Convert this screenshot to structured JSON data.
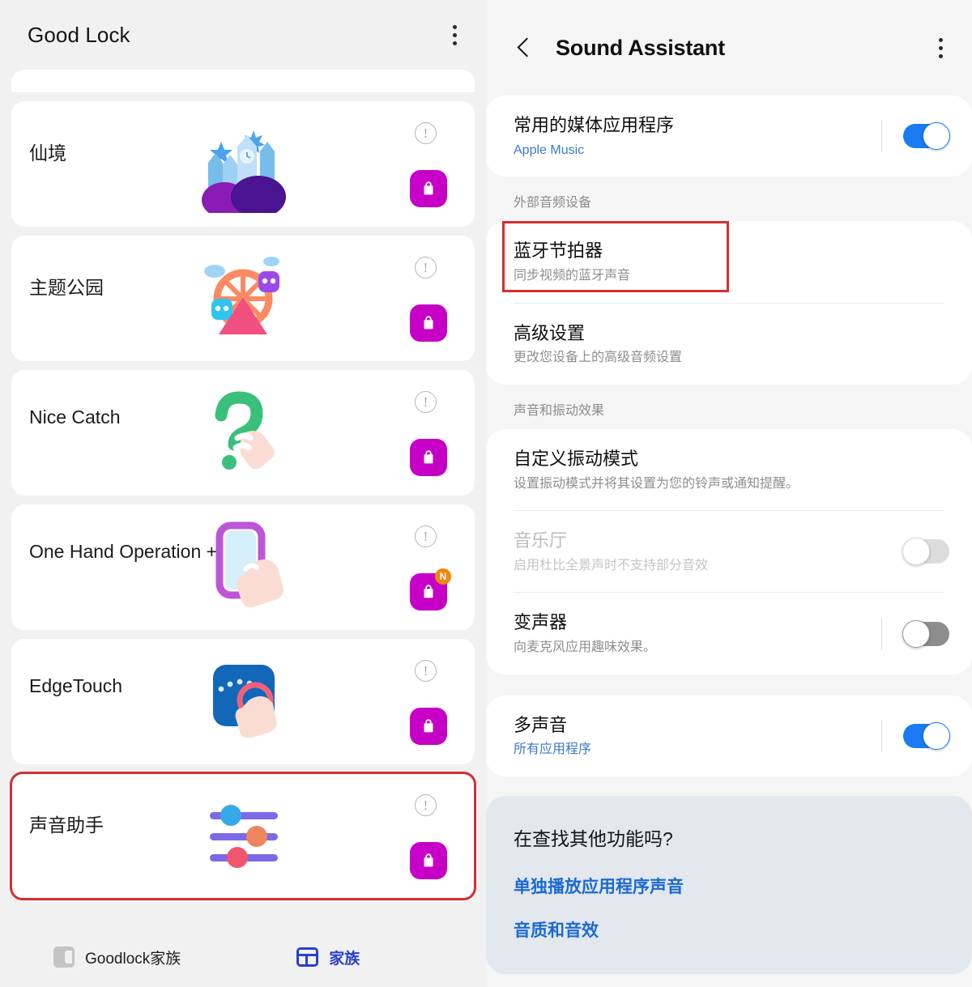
{
  "left": {
    "header": {
      "title": "Good Lock",
      "menu_icon": "kebab-menu-icon"
    },
    "cards": [
      {
        "name": "仙境",
        "art": "wonderland",
        "badge": ""
      },
      {
        "name": "主题公园",
        "art": "themepark",
        "badge": ""
      },
      {
        "name": "Nice Catch",
        "art": "nicecatch",
        "badge": ""
      },
      {
        "name": "One Hand Operation +",
        "art": "onehand",
        "badge": "N"
      },
      {
        "name": "EdgeTouch",
        "art": "edgetouch",
        "badge": ""
      },
      {
        "name": "声音助手",
        "art": "soundassistant",
        "badge": ""
      }
    ],
    "bottom_nav": [
      {
        "label": "Goodlock家族",
        "icon": "goodlock-family-icon",
        "active": false
      },
      {
        "label": "家族",
        "icon": "family-grid-icon",
        "active": true
      }
    ]
  },
  "right": {
    "header": {
      "title": "Sound Assistant",
      "back_icon": "back-chevron-icon",
      "menu_icon": "kebab-menu-icon"
    },
    "groups": [
      {
        "label": "",
        "rows": [
          {
            "title": "常用的媒体应用程序",
            "sub": "Apple Music",
            "sub_style": "blue",
            "toggle": "on"
          }
        ]
      },
      {
        "label": "外部音频设备",
        "rows": [
          {
            "title": "蓝牙节拍器",
            "sub": "同步视频的蓝牙声音",
            "sub_style": "gray",
            "toggle": "none"
          },
          {
            "title": "高级设置",
            "sub": "更改您设备上的高级音频设置",
            "sub_style": "gray",
            "toggle": "none"
          }
        ]
      },
      {
        "label": "声音和振动效果",
        "rows": [
          {
            "title": "自定义振动模式",
            "sub": "设置振动模式并将其设置为您的铃声或通知提醒。",
            "sub_style": "gray",
            "toggle": "none"
          },
          {
            "title": "音乐厅",
            "sub": "启用杜比全景声时不支持部分音效",
            "sub_style": "gray",
            "toggle": "disabled"
          },
          {
            "title": "变声器",
            "sub": "向麦克风应用趣味效果。",
            "sub_style": "gray",
            "toggle": "off"
          }
        ]
      },
      {
        "label": "",
        "rows": [
          {
            "title": "多声音",
            "sub": "所有应用程序",
            "sub_style": "blue",
            "toggle": "on"
          }
        ]
      }
    ],
    "info_card": {
      "question": "在查找其他功能吗?",
      "links": [
        "单独播放应用程序声音",
        "音质和音效"
      ]
    }
  },
  "highlights": {
    "accent_color": "#d32f2f",
    "toggle_on_color": "#1a7cf0",
    "store_color": "#c900c9",
    "active_nav_color": "#2a3fd0"
  }
}
